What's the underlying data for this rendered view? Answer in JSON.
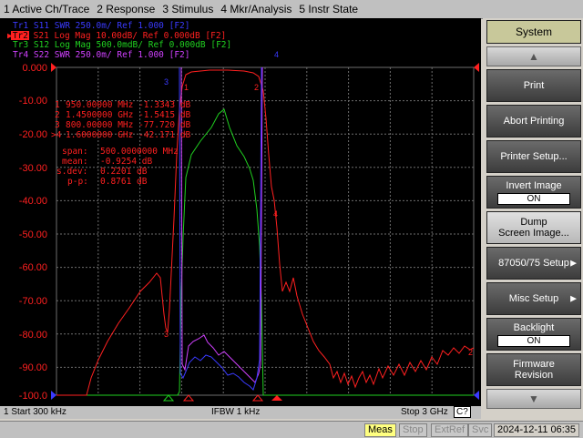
{
  "menu": [
    "1 Active Ch/Trace",
    "2 Response",
    "3 Stimulus",
    "4 Mkr/Analysis",
    "5 Instr State"
  ],
  "traces": [
    {
      "id": "Tr1",
      "text": "S11  SWR  250.0m/ Ref 1.000  [F2]",
      "color": "#3a3aff"
    },
    {
      "id": "Tr2",
      "text": "S21  Log Mag 10.00dB/ Ref 0.000dB [F2]",
      "color": "#ff2020"
    },
    {
      "id": "Tr3",
      "text": "S12  Log Mag 500.0mdB/ Ref 0.000dB [F2]",
      "color": "#20d020"
    },
    {
      "id": "Tr4",
      "text": "S22  SWR  250.0m/ Ref 1.000  [F2]",
      "color": "#d040ff"
    }
  ],
  "y_ticks": [
    "0.000",
    "-10.00",
    "-20.00",
    "-30.00",
    "-40.00",
    "-50.00",
    "-60.00",
    "-70.00",
    "-80.00",
    "-90.00",
    "-100.0"
  ],
  "markers": [
    {
      "num": "1",
      "text": "950.00000 MHz  -1.3343 dB"
    },
    {
      "num": "2",
      "text": "1.4500000 GHz  -1.5415 dB"
    },
    {
      "num": "3",
      "text": "800.00000 MHz  -77.720 dB"
    },
    {
      "num": ">4",
      "text": "1.6000000 GHz  -42.171 dB"
    }
  ],
  "stats": [
    {
      "label": "span:",
      "value": "500.0000000 MHz"
    },
    {
      "label": "mean:",
      "value": "-0.9254 dB"
    },
    {
      "label": "s.dev:",
      "value": "0.2201 dB"
    },
    {
      "label": "p-p:",
      "value": "0.8761 dB"
    }
  ],
  "status": {
    "left": "1  Start 300 kHz",
    "mid": "IFBW 1 kHz",
    "right": "Stop 3 GHz",
    "c2": "C?"
  },
  "bottom": {
    "meas": "Meas",
    "stop": "Stop",
    "extref": "ExtRef",
    "svc": "Svc",
    "datetime": "2024-12-11 06:35"
  },
  "softkeys": {
    "title": "System",
    "print": "Print",
    "abort": "Abort Printing",
    "setup": "Printer Setup...",
    "invert": "Invert Image",
    "invert_val": "ON",
    "dump1": "Dump",
    "dump2": "Screen Image...",
    "setup87050": "87050/75 Setup",
    "misc": "Misc Setup",
    "backlight": "Backlight",
    "backlight_val": "ON",
    "fw1": "Firmware",
    "fw2": "Revision"
  },
  "colors": {
    "tr1": "#3a3aff",
    "tr2": "#ff2020",
    "tr3": "#20d020",
    "tr4": "#d040ff",
    "grid": "#7a7a7a",
    "text_red": "#ff2020"
  }
}
